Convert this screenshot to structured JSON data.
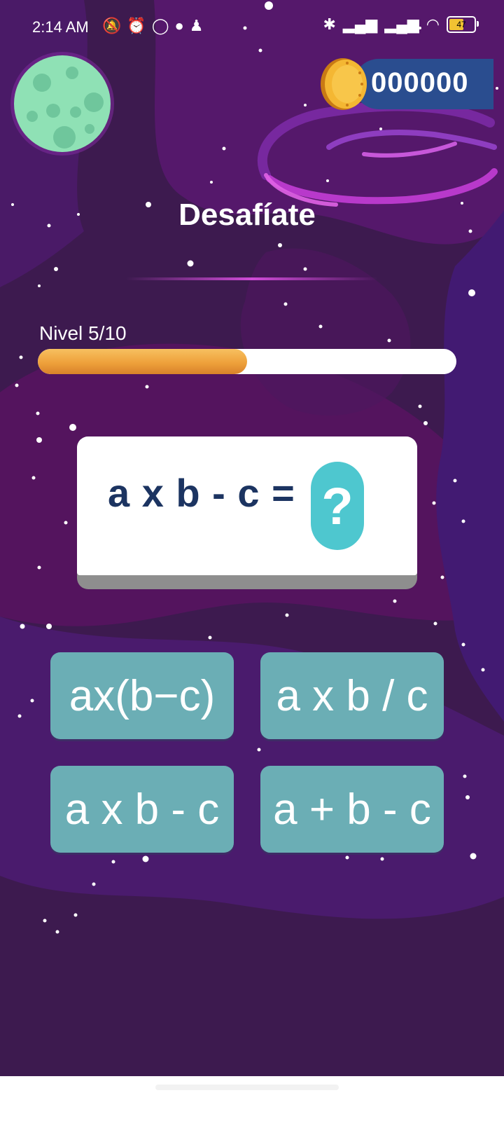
{
  "status_bar": {
    "time": "2:14 AM",
    "battery": "47",
    "notification_icons": [
      "muted-icon",
      "alarm-icon",
      "whatsapp-icon",
      "app-icon",
      "avatar-icon"
    ],
    "right_icons": [
      "bluetooth-icon",
      "signal-icon",
      "signal-icon",
      "wifi-icon",
      "battery-icon"
    ]
  },
  "coins": {
    "value": "000000"
  },
  "title": "Desafíate",
  "level": {
    "label": "Nivel 5/10",
    "progress": 0.5
  },
  "question": {
    "expression": "a x b - c =",
    "unknown": "?"
  },
  "answers": [
    {
      "label": "ax(b−c)"
    },
    {
      "label": "a x b / c"
    },
    {
      "label": "a x b - c"
    },
    {
      "label": "a + b - c"
    }
  ],
  "colors": {
    "background": "#3d1a4f",
    "progress_fill": "#eea13b",
    "answer_button": "#6baeb5",
    "question_text": "#1c3461",
    "question_mark_bg": "#4ec7cf",
    "coin_pill": "#2a4d8f"
  }
}
